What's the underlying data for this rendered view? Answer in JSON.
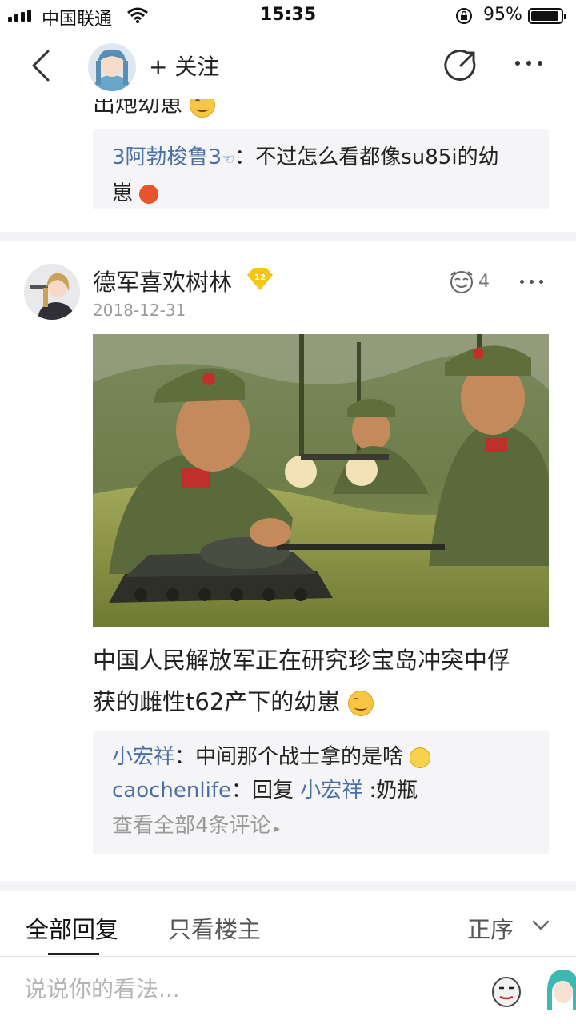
{
  "status_bar": {
    "carrier": "中国联通",
    "time": "15:35",
    "battery_text": "95%",
    "battery_level": 0.95
  },
  "nav": {
    "follow_label": "+ 关注"
  },
  "partial_comment": {
    "text": "出炮幼崽"
  },
  "reply_box_1": {
    "user": "3阿勃梭鲁3",
    "line1": "：不过怎么看都像su85i的幼",
    "line2": "崽"
  },
  "post": {
    "username": "德军喜欢树林",
    "level": "12",
    "date": "2018-12-31",
    "like_count": "4",
    "text_line1": "中国人民解放军正在研究珍宝岛冲突中俘",
    "text_line2": "获的雌性t62产下的幼崽"
  },
  "replies": [
    {
      "user": "小宏祥",
      "text": "：中间那个战士拿的是啥"
    },
    {
      "user": "caochenlife",
      "text": "：回复 ",
      "mention": "小宏祥",
      "tail": " :奶瓶"
    }
  ],
  "view_all": "查看全部4条评论",
  "tabs": {
    "all": "全部回复",
    "op_only": "只看楼主",
    "sort": "正序"
  },
  "comment_bar": {
    "placeholder": "说说你的看法..."
  },
  "colors": {
    "username_blue": "#4a6fa5",
    "reply_bg": "#f5f5f7",
    "level_badge": "#f5c518"
  },
  "icons": [
    "back-icon",
    "share-icon",
    "more-icon",
    "wifi-icon",
    "lock-icon",
    "like-icon",
    "chevron-down-icon",
    "emoji-icon"
  ]
}
